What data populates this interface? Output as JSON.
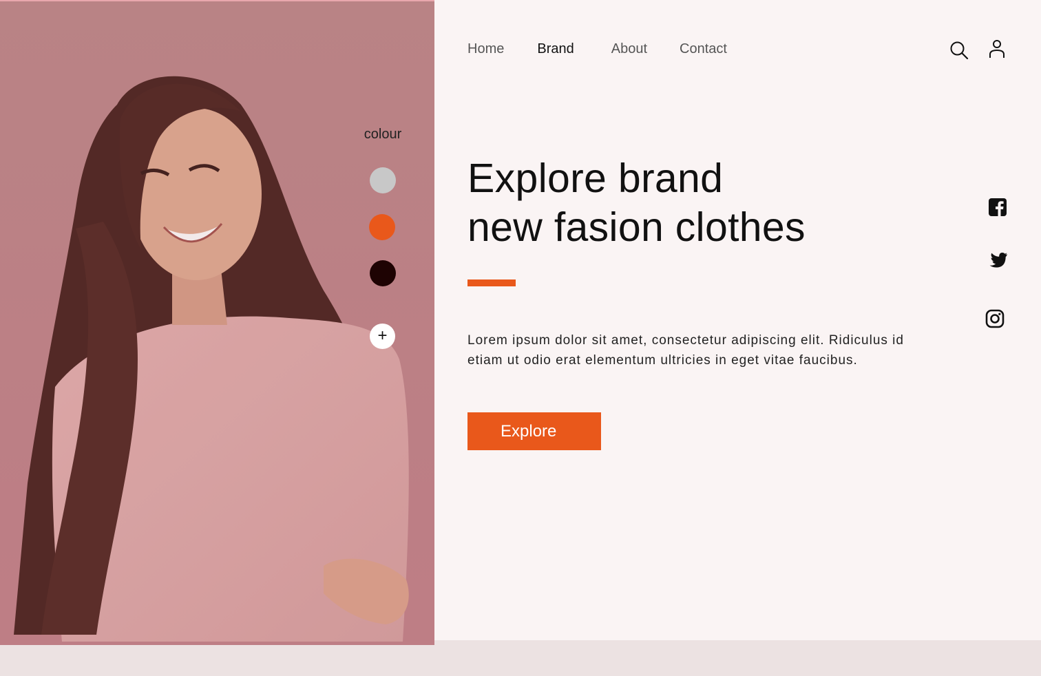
{
  "nav": {
    "items": [
      {
        "label": "Home"
      },
      {
        "label": "Brand"
      },
      {
        "label": "About"
      },
      {
        "label": "Contact"
      }
    ],
    "search_icon": "search-icon",
    "user_icon": "user-icon"
  },
  "colour_picker": {
    "label": "colour",
    "swatches": [
      "#c8c8c8",
      "#e9581b",
      "#1e0303"
    ],
    "add_symbol": "+"
  },
  "hero": {
    "headline_line1": "Explore brand",
    "headline_line2": "new fasion clothes",
    "description": "Lorem ipsum dolor sit amet, consectetur adipiscing elit. Ridiculus id etiam ut odio erat elementum ultricies in eget vitae faucibus.",
    "cta_label": "Explore"
  },
  "social": [
    "facebook-icon",
    "twitter-icon",
    "instagram-icon"
  ],
  "colors": {
    "accent": "#e9581b",
    "panel_bg": "#faf4f4",
    "image_bg": "#c08a8e"
  }
}
